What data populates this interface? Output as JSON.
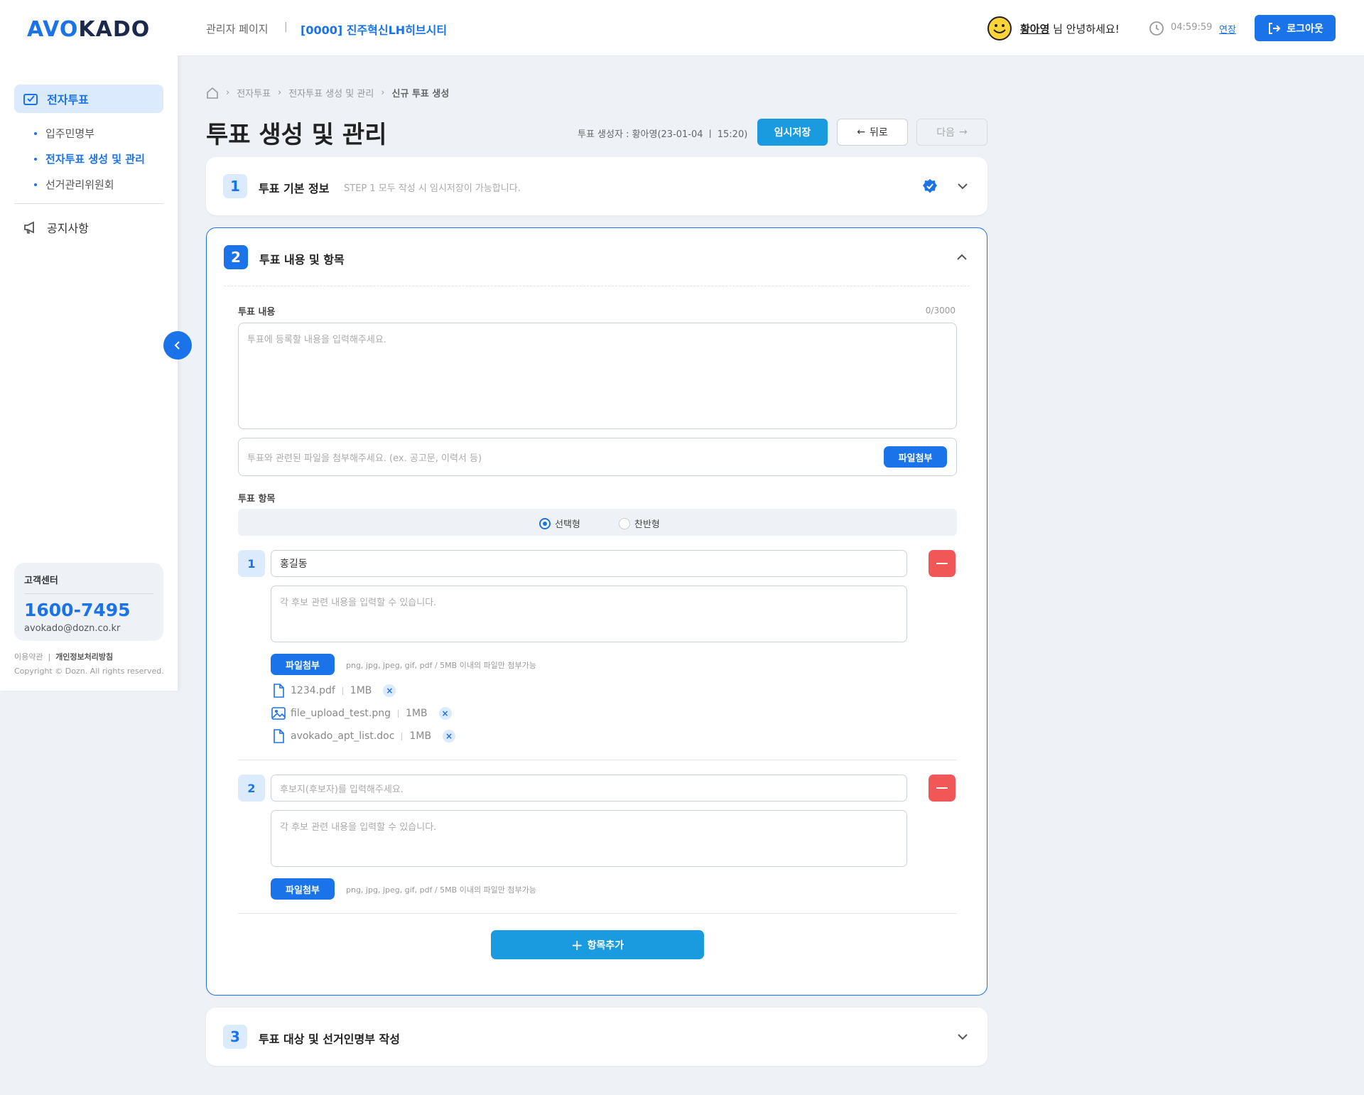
{
  "logo": {
    "part1": "AVO",
    "part2": "KADO"
  },
  "sidebar": {
    "main_item": "전자투표",
    "sub_items": [
      "입주민명부",
      "전자투표 생성 및 관리",
      "선거관리위원회"
    ],
    "notice": "공지사항",
    "cs": {
      "title": "고객센터",
      "phone": "1600-7495",
      "email": "avokado@dozn.co.kr"
    },
    "terms": "이용약관",
    "privacy": "개인정보처리방침",
    "copyright": "Copyright © Dozn. All rights reserved."
  },
  "header": {
    "admin": "관리자 페이지",
    "sep": "|",
    "site": "[0000] 진주혁신LH히브시티",
    "user_name": "황아영",
    "greet_suffix": " 님 안녕하세요!",
    "time": "04:59:59",
    "extend": "연장",
    "logout": "로그아웃"
  },
  "breadcrumb": {
    "items": [
      "전자투표",
      "전자투표 생성 및 관리",
      "신규 투표 생성"
    ]
  },
  "page": {
    "title": "투표 생성 및 관리",
    "meta": "투표 생성자 : 황아영(23-01-04  ㅣ  15:20)",
    "save": "임시저장",
    "back": "뒤로",
    "next": "다음"
  },
  "step1": {
    "num": "1",
    "title": "투표 기본 정보",
    "sub": "STEP 1 모두 작성 시 임시저장이 가능합니다."
  },
  "step2": {
    "num": "2",
    "title": "투표 내용 및 항목",
    "content_label": "투표 내용",
    "counter": "0/3000",
    "content_placeholder": "투표에 등록할 내용을 입력해주세요.",
    "file_placeholder": "투표와 관련된 파일을 첨부해주세요. (ex. 공고문, 이력서 등)",
    "attach": "파일첨부",
    "items_label": "투표 항목",
    "radio_choice": "선택형",
    "radio_yesno": "찬반형",
    "hint": "png, jpg, jpeg, gif, pdf / 5MB 이내의 파일만 첨부가능",
    "desc_placeholder": "각 후보 관련 내용을 입력할 수 있습니다.",
    "items": [
      {
        "num": "1",
        "name": "홍길동",
        "files": [
          {
            "name": "1234.pdf",
            "size": "1MB",
            "icon": "file-icon"
          },
          {
            "name": "file_upload_test.png",
            "size": "1MB",
            "icon": "image-icon"
          },
          {
            "name": "avokado_apt_list.doc",
            "size": "1MB",
            "icon": "file-icon"
          }
        ]
      },
      {
        "num": "2",
        "name_placeholder": "후보지(후보자)를 입력해주세요."
      }
    ],
    "add_item": "항목추가"
  },
  "step3": {
    "num": "3",
    "title": "투표 대상 및 선거인명부 작성"
  },
  "colors": {
    "primary": "#1a73e8",
    "secondary": "#1a9be0",
    "danger": "#f25757"
  }
}
